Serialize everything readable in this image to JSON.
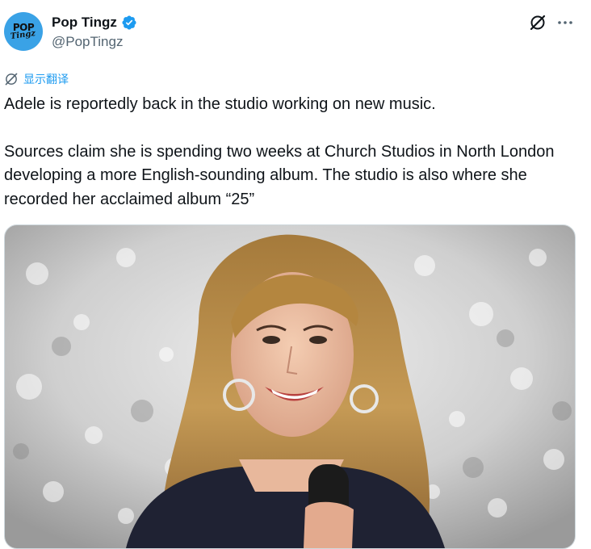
{
  "author": {
    "display_name": "Pop Tingz",
    "handle": "@PopTingz",
    "avatar_text_line1": "POP",
    "avatar_text_line2": "Tingz",
    "verified": true
  },
  "actions": {
    "grok_icon": "grok-icon",
    "more_icon": "more-icon"
  },
  "translate": {
    "label": "显示翻译",
    "icon": "translate-icon"
  },
  "tweet": {
    "paragraph1": "Adele is reportedly back in the studio working on new music.",
    "paragraph2": "Sources claim she is spending two weeks at Church Studios in North London developing a more English-sounding album. The studio is also where she recorded her acclaimed album “25”"
  },
  "colors": {
    "accent": "#1d9bf0",
    "text": "#0f1419",
    "secondary": "#536471",
    "avatar_bg": "#3aa2e6"
  }
}
